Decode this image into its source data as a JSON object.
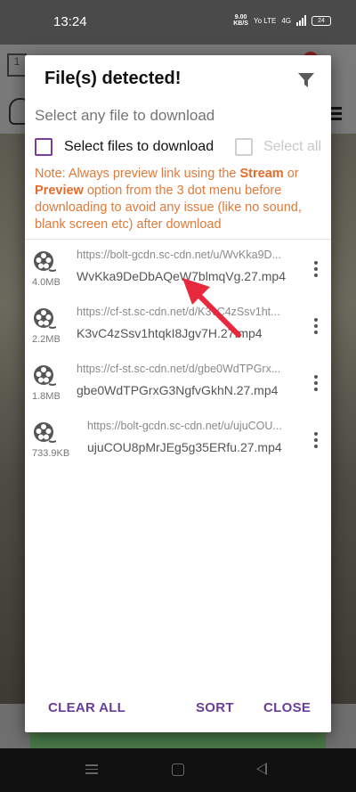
{
  "status_bar": {
    "time": "13:24",
    "net_speed_value": "9.00",
    "net_speed_unit": "KB/S",
    "volte": "Yo LTE",
    "signal": "4G",
    "battery": "24"
  },
  "dialog": {
    "title": "File(s) detected!",
    "subtitle": "Select any file to download",
    "select_files_label": "Select files to download",
    "select_all_label": "Select all",
    "note": {
      "part1": "Note: Always preview link using the ",
      "stream": "Stream",
      "part2": " or ",
      "preview": "Preview",
      "part3": " option from the 3 dot menu before downloading to avoid any issue (like no sound, blank screen etc) after download"
    },
    "files": [
      {
        "size": "4.0MB",
        "url": "https://bolt-gcdn.sc-cdn.net/u/WvKka9D...",
        "name": "WvKka9DeDbAQeW7blmqVg.27.mp4"
      },
      {
        "size": "2.2MB",
        "url": "https://cf-st.sc-cdn.net/d/K3vC4zSsv1ht...",
        "name": "K3vC4zSsv1htqkI8Jgv7H.27.mp4"
      },
      {
        "size": "1.8MB",
        "url": "https://cf-st.sc-cdn.net/d/gbe0WdTPGrx...",
        "name": "gbe0WdTPGrxG3NgfvGkhN.27.mp4"
      },
      {
        "size": "733.9KB",
        "url": "https://bolt-gcdn.sc-cdn.net/u/ujuCOU...",
        "name": "ujuCOU8pMrJEg5g35ERfu.27.mp4"
      }
    ],
    "buttons": {
      "clear_all": "CLEAR ALL",
      "sort": "SORT",
      "close": "CLOSE"
    }
  },
  "background_app": {
    "box_label": "1"
  },
  "colors": {
    "accent": "#6a3d9a",
    "note": "#e07a3a",
    "annotation_arrow": "#e8283c"
  },
  "icons": {
    "filter": "filter-icon",
    "file": "film-reel-icon",
    "more": "more-vertical-icon"
  }
}
